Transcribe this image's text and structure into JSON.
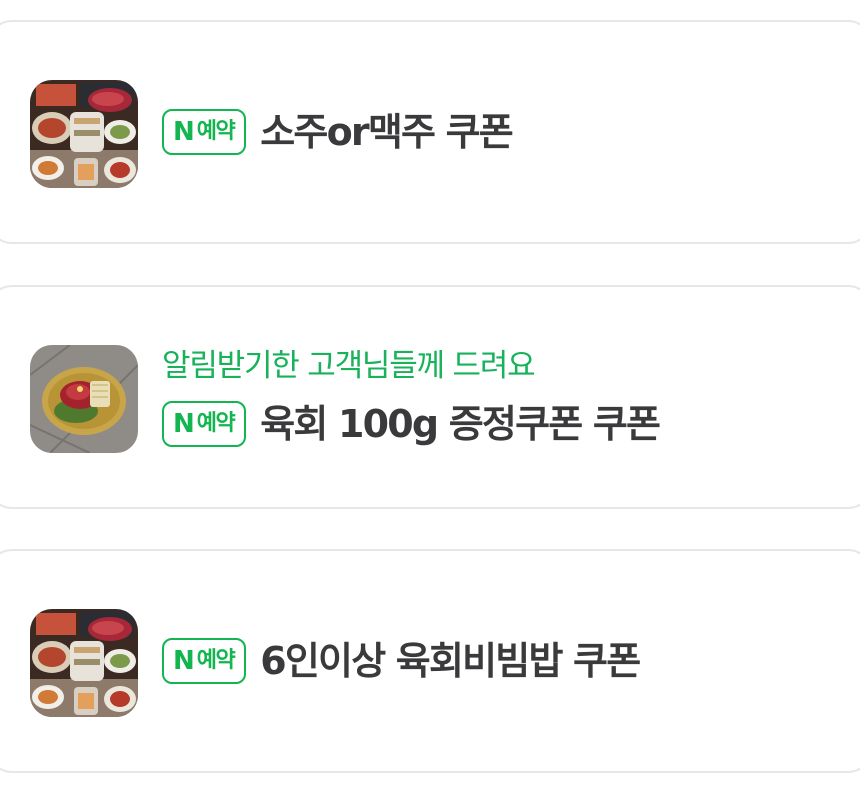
{
  "coupons": [
    {
      "badge": {
        "letter": "N",
        "label": "예약"
      },
      "notice": "",
      "title": "소주or맥주 쿠폰",
      "thumbnail": "food-platter-image"
    },
    {
      "badge": {
        "letter": "N",
        "label": "예약"
      },
      "notice": "알림받기한 고객님들께 드려요",
      "title": "육회 100g 증정쿠폰 쿠폰",
      "thumbnail": "yukhoe-dish-image"
    },
    {
      "badge": {
        "letter": "N",
        "label": "예약"
      },
      "notice": "",
      "title": "6인이상 육회비빔밥 쿠폰",
      "thumbnail": "food-platter-image"
    }
  ],
  "colors": {
    "accent_green": "#17b25a",
    "title_text": "#3a3a3c",
    "card_border": "#e6e7ea"
  }
}
